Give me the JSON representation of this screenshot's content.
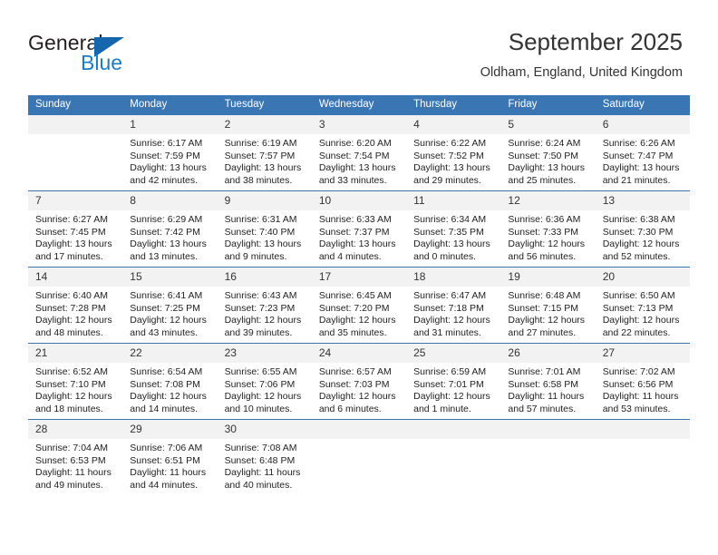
{
  "brand": {
    "name_top": "General",
    "name_bottom": "Blue",
    "triangle_icon": "triangle-icon",
    "colors": {
      "blue": "#1b7cc2",
      "dark": "#231f20",
      "header_blue": "#3a76b4"
    }
  },
  "header": {
    "title": "September 2025",
    "subtitle": "Oldham, England, United Kingdom"
  },
  "weekday_headers": [
    "Sunday",
    "Monday",
    "Tuesday",
    "Wednesday",
    "Thursday",
    "Friday",
    "Saturday"
  ],
  "labels": {
    "sunrise": "Sunrise:",
    "sunset": "Sunset:",
    "daylight": "Daylight:"
  },
  "weeks": [
    [
      {
        "day": "",
        "empty": true
      },
      {
        "day": "1",
        "sunrise": "Sunrise: 6:17 AM",
        "sunset": "Sunset: 7:59 PM",
        "daylight": "Daylight: 13 hours and 42 minutes."
      },
      {
        "day": "2",
        "sunrise": "Sunrise: 6:19 AM",
        "sunset": "Sunset: 7:57 PM",
        "daylight": "Daylight: 13 hours and 38 minutes."
      },
      {
        "day": "3",
        "sunrise": "Sunrise: 6:20 AM",
        "sunset": "Sunset: 7:54 PM",
        "daylight": "Daylight: 13 hours and 33 minutes."
      },
      {
        "day": "4",
        "sunrise": "Sunrise: 6:22 AM",
        "sunset": "Sunset: 7:52 PM",
        "daylight": "Daylight: 13 hours and 29 minutes."
      },
      {
        "day": "5",
        "sunrise": "Sunrise: 6:24 AM",
        "sunset": "Sunset: 7:50 PM",
        "daylight": "Daylight: 13 hours and 25 minutes."
      },
      {
        "day": "6",
        "sunrise": "Sunrise: 6:26 AM",
        "sunset": "Sunset: 7:47 PM",
        "daylight": "Daylight: 13 hours and 21 minutes."
      }
    ],
    [
      {
        "day": "7",
        "sunrise": "Sunrise: 6:27 AM",
        "sunset": "Sunset: 7:45 PM",
        "daylight": "Daylight: 13 hours and 17 minutes."
      },
      {
        "day": "8",
        "sunrise": "Sunrise: 6:29 AM",
        "sunset": "Sunset: 7:42 PM",
        "daylight": "Daylight: 13 hours and 13 minutes."
      },
      {
        "day": "9",
        "sunrise": "Sunrise: 6:31 AM",
        "sunset": "Sunset: 7:40 PM",
        "daylight": "Daylight: 13 hours and 9 minutes."
      },
      {
        "day": "10",
        "sunrise": "Sunrise: 6:33 AM",
        "sunset": "Sunset: 7:37 PM",
        "daylight": "Daylight: 13 hours and 4 minutes."
      },
      {
        "day": "11",
        "sunrise": "Sunrise: 6:34 AM",
        "sunset": "Sunset: 7:35 PM",
        "daylight": "Daylight: 13 hours and 0 minutes."
      },
      {
        "day": "12",
        "sunrise": "Sunrise: 6:36 AM",
        "sunset": "Sunset: 7:33 PM",
        "daylight": "Daylight: 12 hours and 56 minutes."
      },
      {
        "day": "13",
        "sunrise": "Sunrise: 6:38 AM",
        "sunset": "Sunset: 7:30 PM",
        "daylight": "Daylight: 12 hours and 52 minutes."
      }
    ],
    [
      {
        "day": "14",
        "sunrise": "Sunrise: 6:40 AM",
        "sunset": "Sunset: 7:28 PM",
        "daylight": "Daylight: 12 hours and 48 minutes."
      },
      {
        "day": "15",
        "sunrise": "Sunrise: 6:41 AM",
        "sunset": "Sunset: 7:25 PM",
        "daylight": "Daylight: 12 hours and 43 minutes."
      },
      {
        "day": "16",
        "sunrise": "Sunrise: 6:43 AM",
        "sunset": "Sunset: 7:23 PM",
        "daylight": "Daylight: 12 hours and 39 minutes."
      },
      {
        "day": "17",
        "sunrise": "Sunrise: 6:45 AM",
        "sunset": "Sunset: 7:20 PM",
        "daylight": "Daylight: 12 hours and 35 minutes."
      },
      {
        "day": "18",
        "sunrise": "Sunrise: 6:47 AM",
        "sunset": "Sunset: 7:18 PM",
        "daylight": "Daylight: 12 hours and 31 minutes."
      },
      {
        "day": "19",
        "sunrise": "Sunrise: 6:48 AM",
        "sunset": "Sunset: 7:15 PM",
        "daylight": "Daylight: 12 hours and 27 minutes."
      },
      {
        "day": "20",
        "sunrise": "Sunrise: 6:50 AM",
        "sunset": "Sunset: 7:13 PM",
        "daylight": "Daylight: 12 hours and 22 minutes."
      }
    ],
    [
      {
        "day": "21",
        "sunrise": "Sunrise: 6:52 AM",
        "sunset": "Sunset: 7:10 PM",
        "daylight": "Daylight: 12 hours and 18 minutes."
      },
      {
        "day": "22",
        "sunrise": "Sunrise: 6:54 AM",
        "sunset": "Sunset: 7:08 PM",
        "daylight": "Daylight: 12 hours and 14 minutes."
      },
      {
        "day": "23",
        "sunrise": "Sunrise: 6:55 AM",
        "sunset": "Sunset: 7:06 PM",
        "daylight": "Daylight: 12 hours and 10 minutes."
      },
      {
        "day": "24",
        "sunrise": "Sunrise: 6:57 AM",
        "sunset": "Sunset: 7:03 PM",
        "daylight": "Daylight: 12 hours and 6 minutes."
      },
      {
        "day": "25",
        "sunrise": "Sunrise: 6:59 AM",
        "sunset": "Sunset: 7:01 PM",
        "daylight": "Daylight: 12 hours and 1 minute."
      },
      {
        "day": "26",
        "sunrise": "Sunrise: 7:01 AM",
        "sunset": "Sunset: 6:58 PM",
        "daylight": "Daylight: 11 hours and 57 minutes."
      },
      {
        "day": "27",
        "sunrise": "Sunrise: 7:02 AM",
        "sunset": "Sunset: 6:56 PM",
        "daylight": "Daylight: 11 hours and 53 minutes."
      }
    ],
    [
      {
        "day": "28",
        "sunrise": "Sunrise: 7:04 AM",
        "sunset": "Sunset: 6:53 PM",
        "daylight": "Daylight: 11 hours and 49 minutes."
      },
      {
        "day": "29",
        "sunrise": "Sunrise: 7:06 AM",
        "sunset": "Sunset: 6:51 PM",
        "daylight": "Daylight: 11 hours and 44 minutes."
      },
      {
        "day": "30",
        "sunrise": "Sunrise: 7:08 AM",
        "sunset": "Sunset: 6:48 PM",
        "daylight": "Daylight: 11 hours and 40 minutes."
      },
      {
        "day": "",
        "empty": true
      },
      {
        "day": "",
        "empty": true
      },
      {
        "day": "",
        "empty": true
      },
      {
        "day": "",
        "empty": true
      }
    ]
  ]
}
